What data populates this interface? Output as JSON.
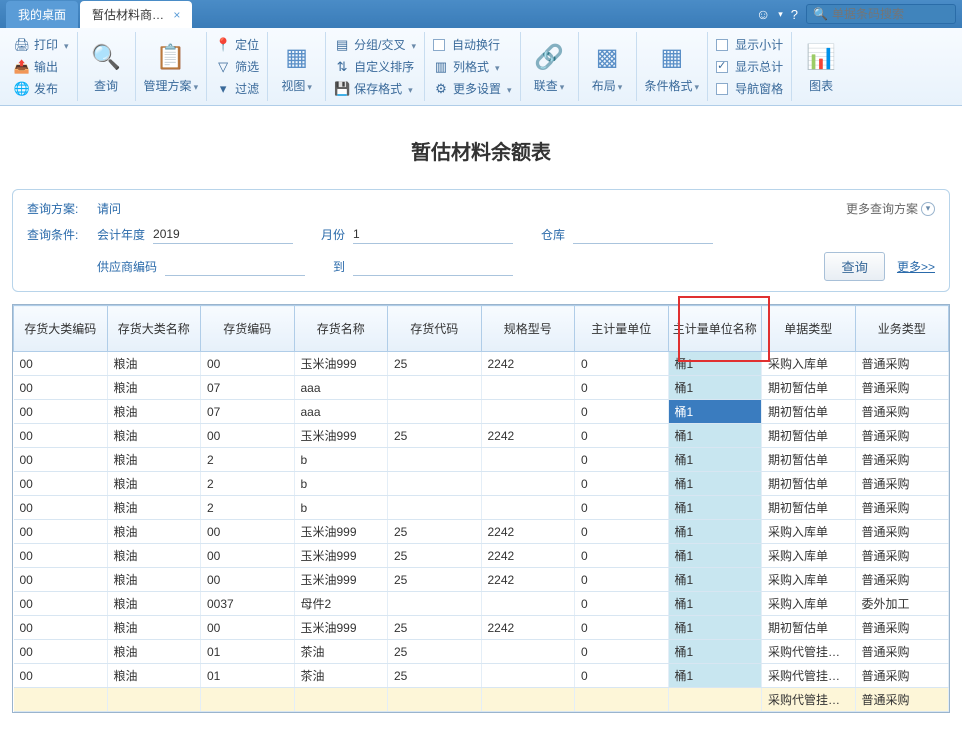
{
  "topbar": {
    "tab_desktop": "我的桌面",
    "tab_active": "暂估材料商…",
    "search_placeholder": "单据条码搜索"
  },
  "ribbon": {
    "print": "打印",
    "export": "输出",
    "publish": "发布",
    "query": "查询",
    "mgmt": "管理方案",
    "locate": "定位",
    "filter": "筛选",
    "filtero": "过滤",
    "view": "视图",
    "group": "分组/交叉",
    "sort": "自定义排序",
    "savefmt": "保存格式",
    "autowrap": "自动换行",
    "colfmt": "列格式",
    "moreset": "更多设置",
    "link": "联查",
    "layout": "布局",
    "condfmt": "条件格式",
    "subtotal": "显示小计",
    "total": "显示总计",
    "navpane": "导航窗格",
    "chart": "图表"
  },
  "title": "暂估材料余额表",
  "query": {
    "scheme_label": "查询方案:",
    "scheme_val": "请问",
    "more_scheme": "更多查询方案",
    "cond_label": "查询条件:",
    "year_label": "会计年度",
    "year_val": "2019",
    "month_label": "月份",
    "month_val": "1",
    "wh_label": "仓库",
    "wh_val": "",
    "supp_label": "供应商编码",
    "supp_val": "",
    "to_label": "到",
    "to_val": "",
    "btn": "查询",
    "more": "更多>>"
  },
  "cols": [
    "存货大类编码",
    "存货大类名称",
    "存货编码",
    "存货名称",
    "存货代码",
    "规格型号",
    "主计量单位",
    "主计量单位名称",
    "单据类型",
    "业务类型"
  ],
  "widths": [
    90,
    90,
    90,
    90,
    90,
    90,
    90,
    90,
    90,
    90
  ],
  "rows": [
    [
      "00",
      "粮油",
      "00",
      "玉米油999",
      "25",
      "2242",
      "0",
      "桶1",
      "采购入库单",
      "普通采购"
    ],
    [
      "00",
      "粮油",
      "07",
      "aaa",
      "",
      "",
      "0",
      "桶1",
      "期初暂估单",
      "普通采购"
    ],
    [
      "00",
      "粮油",
      "07",
      "aaa",
      "",
      "",
      "0",
      "桶1",
      "期初暂估单",
      "普通采购"
    ],
    [
      "00",
      "粮油",
      "00",
      "玉米油999",
      "25",
      "2242",
      "0",
      "桶1",
      "期初暂估单",
      "普通采购"
    ],
    [
      "00",
      "粮油",
      "2",
      "b",
      "",
      "",
      "0",
      "桶1",
      "期初暂估单",
      "普通采购"
    ],
    [
      "00",
      "粮油",
      "2",
      "b",
      "",
      "",
      "0",
      "桶1",
      "期初暂估单",
      "普通采购"
    ],
    [
      "00",
      "粮油",
      "2",
      "b",
      "",
      "",
      "0",
      "桶1",
      "期初暂估单",
      "普通采购"
    ],
    [
      "00",
      "粮油",
      "00",
      "玉米油999",
      "25",
      "2242",
      "0",
      "桶1",
      "采购入库单",
      "普通采购"
    ],
    [
      "00",
      "粮油",
      "00",
      "玉米油999",
      "25",
      "2242",
      "0",
      "桶1",
      "采购入库单",
      "普通采购"
    ],
    [
      "00",
      "粮油",
      "00",
      "玉米油999",
      "25",
      "2242",
      "0",
      "桶1",
      "采购入库单",
      "普通采购"
    ],
    [
      "00",
      "粮油",
      "0037",
      "母件2",
      "",
      "",
      "0",
      "桶1",
      "采购入库单",
      "委外加工"
    ],
    [
      "00",
      "粮油",
      "00",
      "玉米油999",
      "25",
      "2242",
      "0",
      "桶1",
      "期初暂估单",
      "普通采购"
    ],
    [
      "00",
      "粮油",
      "01",
      "茶油",
      "25",
      "",
      "0",
      "桶1",
      "采购代管挂…",
      "普通采购"
    ],
    [
      "00",
      "粮油",
      "01",
      "茶油",
      "25",
      "",
      "0",
      "桶1",
      "采购代管挂…",
      "普通采购"
    ],
    [
      "",
      "",
      "",
      "",
      "",
      "",
      "",
      "",
      "采购代管挂…",
      "普通采购"
    ]
  ],
  "selected_row": 2,
  "highlight_col": 7
}
